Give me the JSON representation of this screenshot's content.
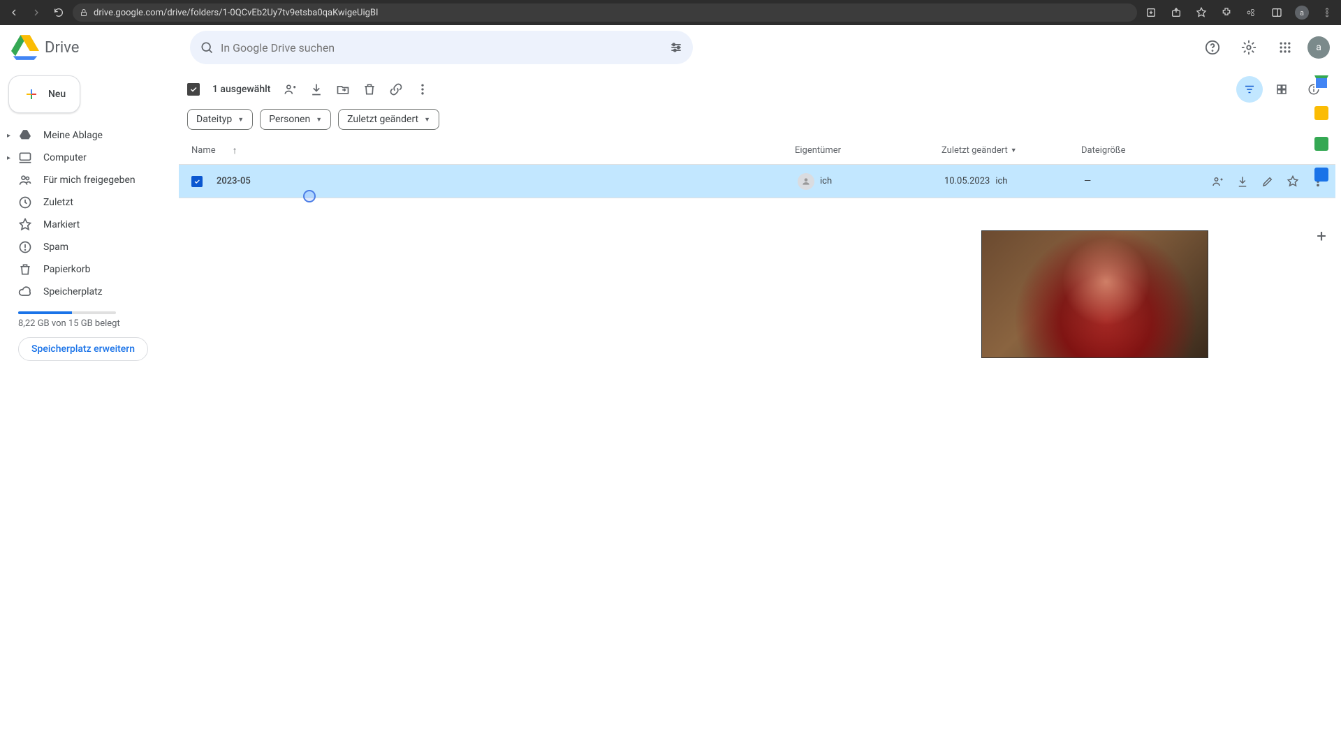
{
  "browser": {
    "url": "drive.google.com/drive/folders/1-0QCvEb2Uy7tv9etsba0qaKwigeUigBI"
  },
  "product_name": "Drive",
  "search": {
    "placeholder": "In Google Drive suchen"
  },
  "new_button": "Neu",
  "sidebar": {
    "items": [
      {
        "label": "Meine Ablage"
      },
      {
        "label": "Computer"
      },
      {
        "label": "Für mich freigegeben"
      },
      {
        "label": "Zuletzt"
      },
      {
        "label": "Markiert"
      },
      {
        "label": "Spam"
      },
      {
        "label": "Papierkorb"
      },
      {
        "label": "Speicherplatz"
      }
    ],
    "storage_text": "8,22 GB von 15 GB belegt",
    "upgrade_label": "Speicherplatz erweitern"
  },
  "selection": {
    "label": "1 ausgewählt"
  },
  "filters": {
    "type": "Dateityp",
    "people": "Personen",
    "modified": "Zuletzt geändert"
  },
  "columns": {
    "name": "Name",
    "owner": "Eigentümer",
    "modified": "Zuletzt geändert",
    "size": "Dateigröße"
  },
  "rows": [
    {
      "name": "2023-05",
      "owner": "ich",
      "modified_date": "10.05.2023",
      "modified_by": "ich",
      "size": "—"
    }
  ],
  "avatar_letter": "a"
}
